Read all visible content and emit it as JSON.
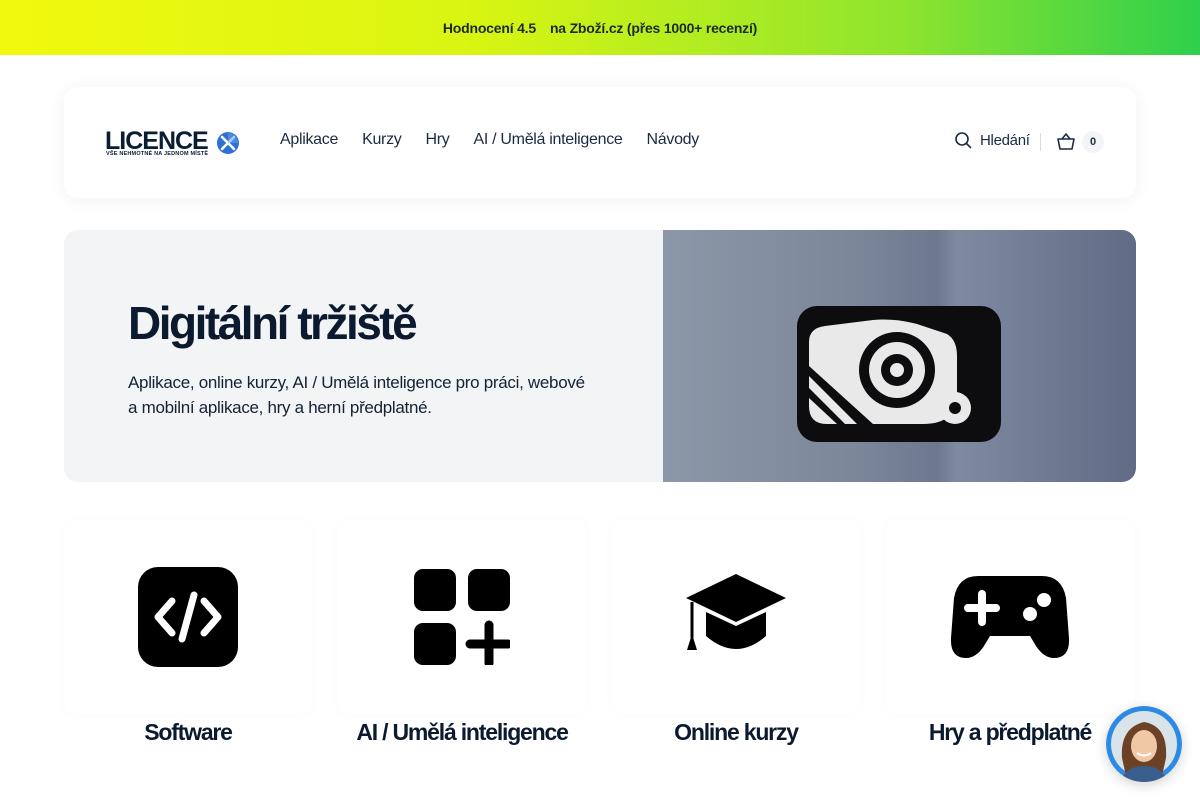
{
  "promo": {
    "rating": "Hodnocení 4.5",
    "source": "na Zboží.cz (přes 1000+ recenzí)"
  },
  "header": {
    "logo": {
      "name": "LICENCE",
      "tagline": "VŠE NEHMOTNÉ NA JEDNOM MÍSTĚ"
    },
    "nav": [
      "Aplikace",
      "Kurzy",
      "Hry",
      "AI / Umělá inteligence",
      "Návody"
    ],
    "search_label": "Hledání",
    "cart_count": "0"
  },
  "hero": {
    "title": "Digitální tržiště",
    "subtitle": "Aplikace, online kurzy, AI / Umělá inteligence pro práci, webové a mobilní aplikace, hry a herní předplatné."
  },
  "categories": [
    {
      "label": "Software",
      "icon": "code-icon"
    },
    {
      "label": "AI / Umělá inteligence",
      "icon": "apps-add-icon"
    },
    {
      "label": "Online kurzy",
      "icon": "graduation-cap-icon"
    },
    {
      "label": "Hry a předplatné",
      "icon": "gamepad-icon"
    }
  ],
  "colors": {
    "promo_gradient_start": "#f1f90e",
    "promo_gradient_end": "#2fcf4c",
    "text_dark": "#0b1a2e",
    "hero_bg": "#f2f4f5"
  }
}
